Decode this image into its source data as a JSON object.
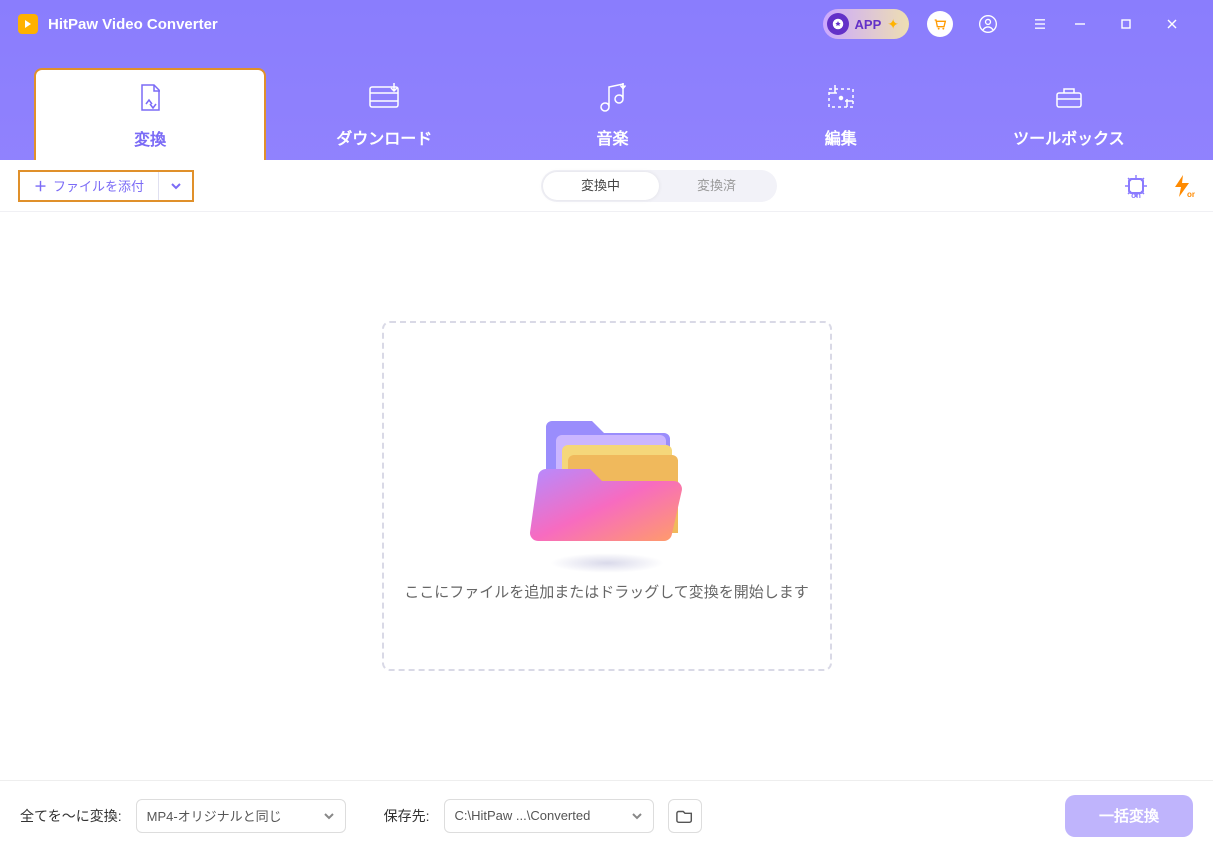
{
  "app": {
    "title": "HitPaw Video Converter",
    "app_pill": "APP"
  },
  "nav": {
    "tabs": [
      {
        "label": "変換"
      },
      {
        "label": "ダウンロード"
      },
      {
        "label": "音楽"
      },
      {
        "label": "編集"
      },
      {
        "label": "ツールボックス"
      }
    ]
  },
  "subbar": {
    "add_file_label": "ファイルを添付",
    "segments": [
      "変換中",
      "変換済"
    ],
    "cpu_badge": "on",
    "bolt_badge": "on"
  },
  "dropzone": {
    "hint": "ここにファイルを追加またはドラッグして変換を開始します"
  },
  "footer": {
    "convert_all_label": "全てを～に変換:",
    "format_value": "MP4-オリジナルと同じ",
    "save_to_label": "保存先:",
    "save_to_value": "C:\\HitPaw ...\\Converted",
    "batch_label": "一括変換"
  }
}
